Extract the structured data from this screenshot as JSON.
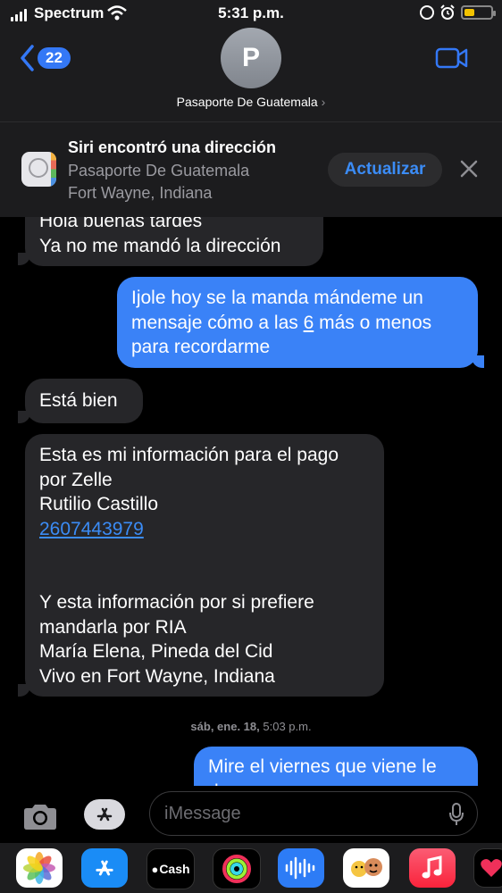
{
  "status_bar": {
    "carrier": "Spectrum",
    "time": "5:31 p.m.",
    "battery_level": 0.4
  },
  "header": {
    "back_count": "22",
    "avatar_initial": "P",
    "contact_name": "Pasaporte De Guatemala",
    "chevron": "›"
  },
  "siri_banner": {
    "title": "Siri encontró una dirección",
    "line1": "Pasaporte De Guatemala",
    "line2": "Fort Wayne, Indiana",
    "update_label": "Actualizar"
  },
  "messages": [
    {
      "side": "in",
      "text": "Hola buenas tardes\nYa no me mandó la dirección"
    },
    {
      "side": "out",
      "text_before": "Ijole hoy se la manda mándeme un\nmensaje cómo a las ",
      "link": "6",
      "text_after": " más o menos\npara recordarme"
    },
    {
      "side": "in",
      "text": "Está bien"
    },
    {
      "side": "in",
      "text": "Esta es mi información para el pago\npor Zelle\nRutilio  Castillo",
      "link": "2607443979",
      "text_after": "\n\n\nY esta información por si prefiere\nmandarla por RIA\nMaría  Elena,  Pineda  del Cid\nVivo en Fort Wayne, Indiana"
    },
    {
      "side": "out",
      "text": "Mire el viernes que viene le\nde"
    }
  ],
  "timestamp": {
    "day": "sáb, ene. 18,",
    "time": "5:03 p.m."
  },
  "input": {
    "placeholder": "iMessage"
  },
  "apps": [
    {
      "name": "photos-icon",
      "label": ""
    },
    {
      "name": "app-store-icon",
      "label": ""
    },
    {
      "name": "apple-cash-icon",
      "label": "Cash"
    },
    {
      "name": "activity-icon",
      "label": ""
    },
    {
      "name": "audio-message-icon",
      "label": ""
    },
    {
      "name": "memoji-icon",
      "label": ""
    },
    {
      "name": "music-icon",
      "label": ""
    },
    {
      "name": "digital-touch-icon",
      "label": ""
    }
  ],
  "colors": {
    "outgoing_bubble": "#3a82f7",
    "incoming_bubble": "#262629",
    "accent": "#3478f6"
  }
}
